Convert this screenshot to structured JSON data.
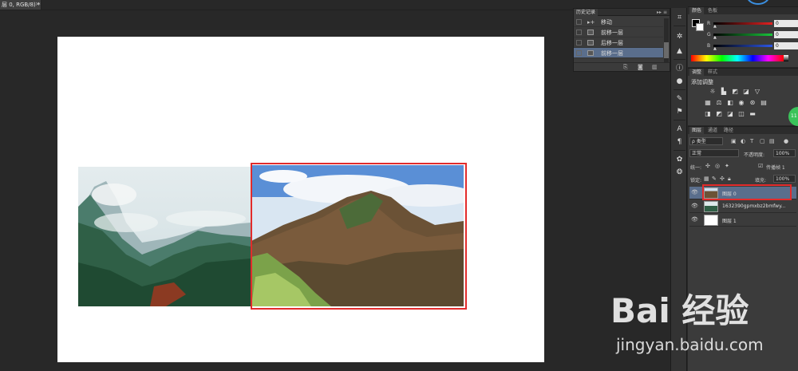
{
  "document": {
    "tab_title": "层 0, RGB/8) *",
    "close_glyph": "×"
  },
  "history": {
    "tab": "历史记录",
    "controls": "▸▸  ≡",
    "items": [
      {
        "label": "移动",
        "selected": false
      },
      {
        "label": "前移一层",
        "selected": false
      },
      {
        "label": "后移一层",
        "selected": false
      },
      {
        "label": "前移一层",
        "selected": true
      }
    ],
    "footer_icons": [
      "new-snapshot-icon",
      "camera-icon",
      "trash-icon"
    ]
  },
  "tools": [
    "history-brush-icon",
    "asterisk-icon",
    "levels-icon",
    "info-icon",
    "info-circle-icon",
    "brush-settings-icon",
    "clone-source-icon",
    "character-icon",
    "paragraph-icon",
    "shapes-icon",
    "styles-icon"
  ],
  "color_panel": {
    "tabs": [
      "颜色",
      "色板"
    ],
    "fg": "#000000",
    "bg": "#ffffff",
    "channels": [
      {
        "label": "R",
        "value": "0",
        "color": "#e32121"
      },
      {
        "label": "G",
        "value": "0",
        "color": "#19c43b"
      },
      {
        "label": "B",
        "value": "0",
        "color": "#2d57e6"
      }
    ]
  },
  "adjust_panel": {
    "tabs": [
      "调整",
      "样式"
    ],
    "title": "添加调整"
  },
  "layers_panel": {
    "tabs": [
      "图层",
      "通道",
      "路径"
    ],
    "filter_kind": "ρ 类型",
    "blend_mode": "正常",
    "opacity_label": "不透明度:",
    "opacity_value": "100%",
    "unify_label": "统一:",
    "propagate_label": "传播帧 1",
    "lock_label": "锁定:",
    "fill_label": "填充:",
    "fill_value": "100%",
    "layers": [
      {
        "name": "图层 0",
        "selected": true
      },
      {
        "name": "1632390gpmxbz2bmfwy...",
        "selected": false
      },
      {
        "name": "图层 1",
        "selected": false
      }
    ]
  },
  "badge": {
    "text": "11"
  },
  "watermark": {
    "brand": "Bai 经验",
    "url": "jingyan.baidu.com"
  }
}
